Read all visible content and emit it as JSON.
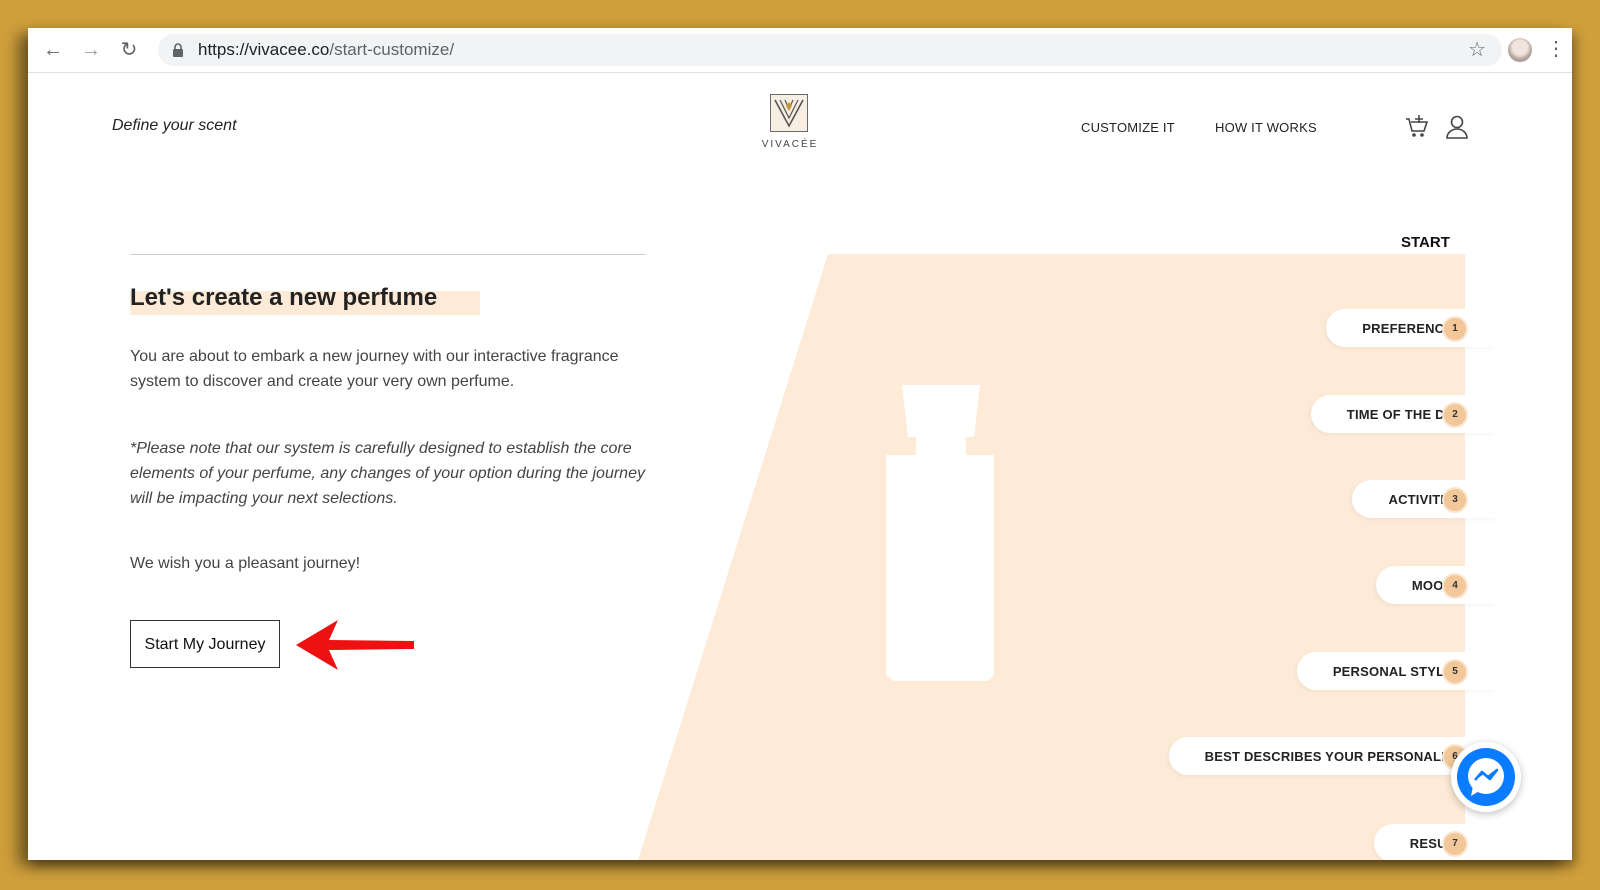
{
  "browser": {
    "url_domain": "https://vivacee.co",
    "url_path": "/start-customize/"
  },
  "header": {
    "tagline": "Define your scent",
    "brand": "VIVACÉE",
    "nav": [
      "CUSTOMIZE IT",
      "HOW IT WORKS"
    ]
  },
  "intro": {
    "title": "Let's create a new perfume",
    "paragraph": "You are about to embark a new journey with our interactive fragrance system to discover and create your very own perfume.",
    "note": "*Please note that our system is carefully designed to establish the core elements of your perfume, any changes of your option during the journey will be impacting your next selections.",
    "wish": "We wish you a pleasant journey!",
    "button": "Start My Journey"
  },
  "steps": {
    "start_label": "START",
    "items": [
      {
        "label": "PREFERENCES",
        "num": "1"
      },
      {
        "label": "TIME OF THE DAY",
        "num": "2"
      },
      {
        "label": "ACTIVITIES",
        "num": "3"
      },
      {
        "label": "MOODS",
        "num": "4"
      },
      {
        "label": "PERSONAL STYLES",
        "num": "5"
      },
      {
        "label": "BEST DESCRIBES YOUR PERSONALITY",
        "num": "6"
      },
      {
        "label": "RESULT",
        "num": "7"
      }
    ]
  },
  "colors": {
    "frame": "#cf9f3c",
    "panel": "#fdebd8",
    "badge": "#f2c89a",
    "messenger": "#0a7cff",
    "annotation_arrow": "#ee1111"
  },
  "icons": [
    "back-arrow-icon",
    "forward-arrow-icon",
    "reload-icon",
    "lock-icon",
    "star-icon",
    "more-vert-icon",
    "logo-icon",
    "cart-icon",
    "user-icon",
    "annotation-arrow-icon",
    "messenger-icon"
  ]
}
